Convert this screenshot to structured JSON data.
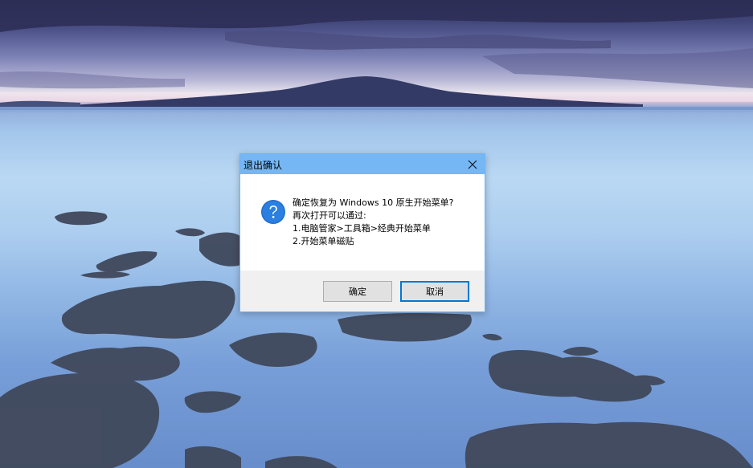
{
  "dialog": {
    "title": "退出确认",
    "close_icon": "close-icon",
    "question_icon": "question-icon",
    "message_lines": [
      "确定恢复为 Windows 10 原生开始菜单?",
      "再次打开可以通过:",
      "1.电脑管家>工具箱>经典开始菜单",
      "2.开始菜单磁贴"
    ],
    "ok_label": "确定",
    "cancel_label": "取消"
  },
  "colors": {
    "titlebar": "#74b7f4",
    "default_button_border": "#0078d7",
    "footer": "#f0f0f0"
  }
}
